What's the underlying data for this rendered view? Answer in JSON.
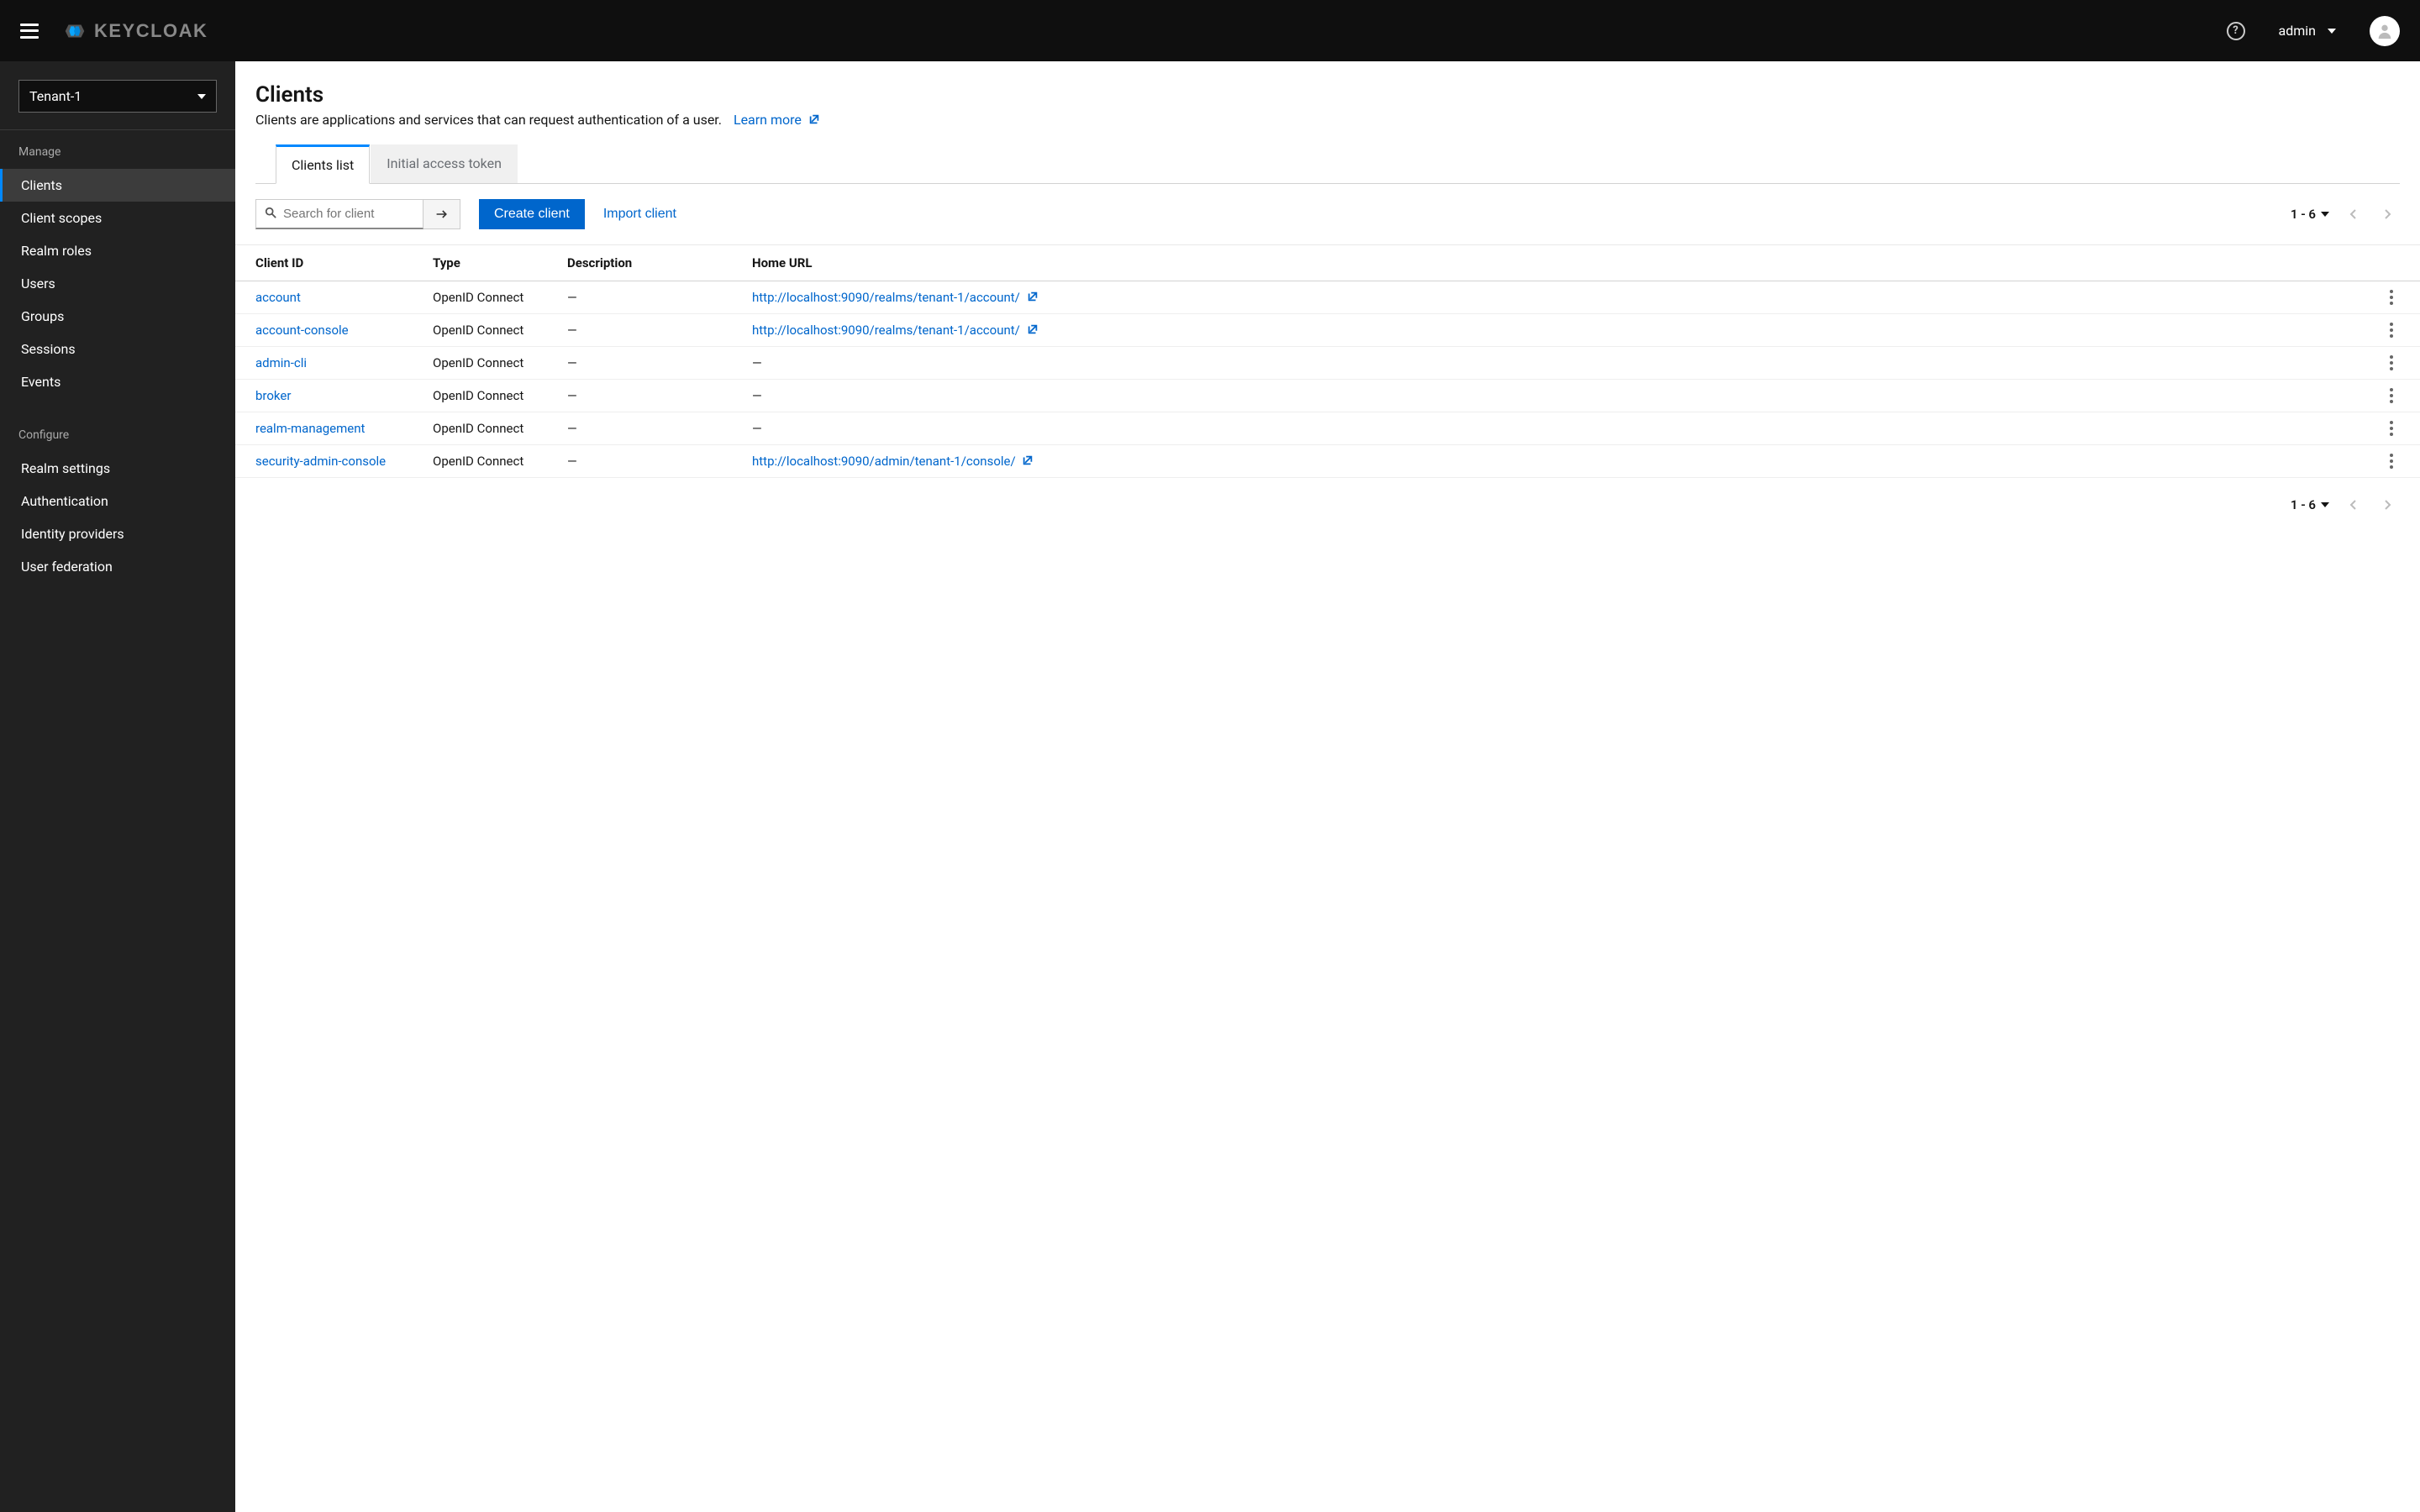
{
  "header": {
    "brand": "KEYCLOAK",
    "help_tooltip": "?",
    "user_label": "admin"
  },
  "sidebar": {
    "realm_selected": "Tenant-1",
    "sections": [
      {
        "title": "Manage",
        "items": [
          {
            "label": "Clients",
            "active": true,
            "name": "sidebar-item-clients"
          },
          {
            "label": "Client scopes",
            "active": false,
            "name": "sidebar-item-client-scopes"
          },
          {
            "label": "Realm roles",
            "active": false,
            "name": "sidebar-item-realm-roles"
          },
          {
            "label": "Users",
            "active": false,
            "name": "sidebar-item-users"
          },
          {
            "label": "Groups",
            "active": false,
            "name": "sidebar-item-groups"
          },
          {
            "label": "Sessions",
            "active": false,
            "name": "sidebar-item-sessions"
          },
          {
            "label": "Events",
            "active": false,
            "name": "sidebar-item-events"
          }
        ]
      },
      {
        "title": "Configure",
        "items": [
          {
            "label": "Realm settings",
            "active": false,
            "name": "sidebar-item-realm-settings"
          },
          {
            "label": "Authentication",
            "active": false,
            "name": "sidebar-item-authentication"
          },
          {
            "label": "Identity providers",
            "active": false,
            "name": "sidebar-item-identity-providers"
          },
          {
            "label": "User federation",
            "active": false,
            "name": "sidebar-item-user-federation"
          }
        ]
      }
    ]
  },
  "page": {
    "title": "Clients",
    "description": "Clients are applications and services that can request authentication of a user.",
    "learn_more": "Learn more"
  },
  "tabs": [
    {
      "label": "Clients list",
      "active": true
    },
    {
      "label": "Initial access token",
      "active": false
    }
  ],
  "toolbar": {
    "search_placeholder": "Search for client",
    "create_label": "Create client",
    "import_label": "Import client"
  },
  "pagination": {
    "range": "1 - 6"
  },
  "table": {
    "columns": {
      "client_id": "Client ID",
      "type": "Type",
      "description": "Description",
      "home_url": "Home URL"
    },
    "rows": [
      {
        "id": "account",
        "type": "OpenID Connect",
        "desc": "—",
        "url": "http://localhost:9090/realms/tenant-1/account/"
      },
      {
        "id": "account-console",
        "type": "OpenID Connect",
        "desc": "—",
        "url": "http://localhost:9090/realms/tenant-1/account/"
      },
      {
        "id": "admin-cli",
        "type": "OpenID Connect",
        "desc": "—",
        "url": "—"
      },
      {
        "id": "broker",
        "type": "OpenID Connect",
        "desc": "—",
        "url": "—"
      },
      {
        "id": "realm-management",
        "type": "OpenID Connect",
        "desc": "—",
        "url": "—"
      },
      {
        "id": "security-admin-console",
        "type": "OpenID Connect",
        "desc": "—",
        "url": "http://localhost:9090/admin/tenant-1/console/"
      }
    ]
  }
}
